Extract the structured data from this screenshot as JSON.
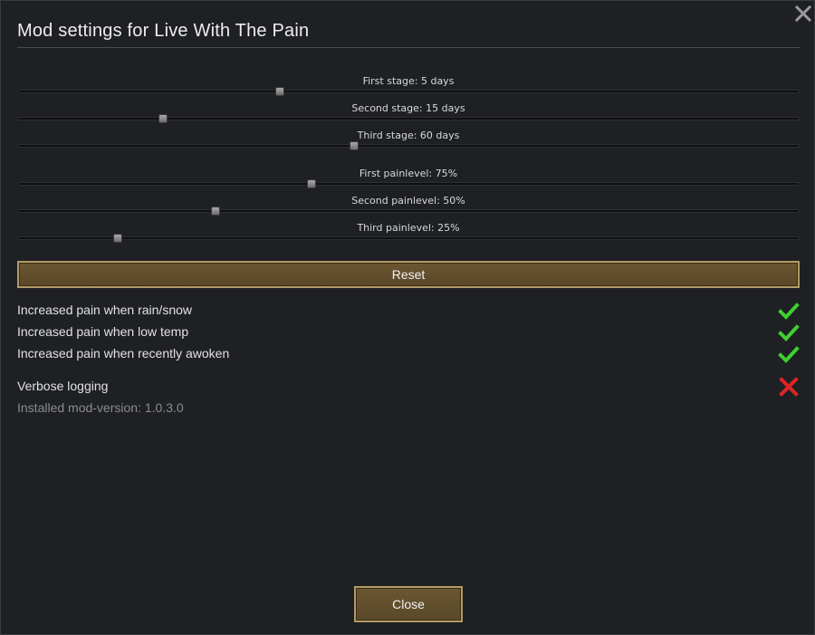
{
  "dialog": {
    "title": "Mod settings for Live With The Pain"
  },
  "sliders": [
    {
      "label": "First stage: 5 days",
      "value_fraction": 0.336
    },
    {
      "label": "Second stage: 15 days",
      "value_fraction": 0.186
    },
    {
      "label": "Third stage: 60 days",
      "value_fraction": 0.43
    },
    {
      "label": "First painlevel: 75%",
      "value_fraction": 0.376
    },
    {
      "label": "Second painlevel: 50%",
      "value_fraction": 0.253
    },
    {
      "label": "Third painlevel: 25%",
      "value_fraction": 0.129
    }
  ],
  "reset_label": "Reset",
  "options": [
    {
      "label": "Increased pain when rain/snow",
      "checked": true
    },
    {
      "label": "Increased pain when low temp",
      "checked": true
    },
    {
      "label": "Increased pain when recently awoken",
      "checked": true
    },
    {
      "label": "Verbose logging",
      "checked": false
    }
  ],
  "version_text": "Installed mod-version: 1.0.3.0",
  "close_label": "Close",
  "colors": {
    "check_on": "#3fcf2f",
    "check_off": "#e02424",
    "button_fill": "#5f4c2c",
    "button_border": "#b39a66"
  }
}
